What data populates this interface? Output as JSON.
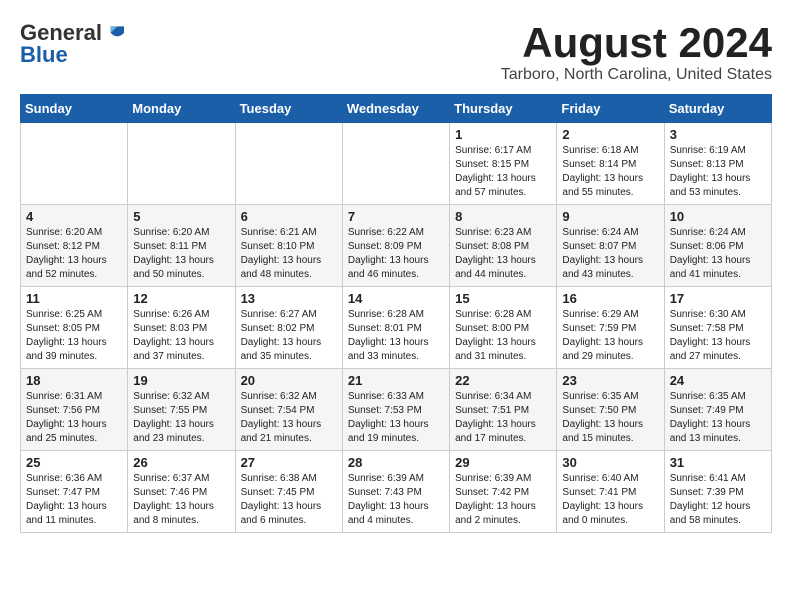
{
  "header": {
    "logo_general": "General",
    "logo_blue": "Blue",
    "month_title": "August 2024",
    "location": "Tarboro, North Carolina, United States"
  },
  "weekdays": [
    "Sunday",
    "Monday",
    "Tuesday",
    "Wednesday",
    "Thursday",
    "Friday",
    "Saturday"
  ],
  "weeks": [
    [
      {
        "day": "",
        "info": ""
      },
      {
        "day": "",
        "info": ""
      },
      {
        "day": "",
        "info": ""
      },
      {
        "day": "",
        "info": ""
      },
      {
        "day": "1",
        "info": "Sunrise: 6:17 AM\nSunset: 8:15 PM\nDaylight: 13 hours\nand 57 minutes."
      },
      {
        "day": "2",
        "info": "Sunrise: 6:18 AM\nSunset: 8:14 PM\nDaylight: 13 hours\nand 55 minutes."
      },
      {
        "day": "3",
        "info": "Sunrise: 6:19 AM\nSunset: 8:13 PM\nDaylight: 13 hours\nand 53 minutes."
      }
    ],
    [
      {
        "day": "4",
        "info": "Sunrise: 6:20 AM\nSunset: 8:12 PM\nDaylight: 13 hours\nand 52 minutes."
      },
      {
        "day": "5",
        "info": "Sunrise: 6:20 AM\nSunset: 8:11 PM\nDaylight: 13 hours\nand 50 minutes."
      },
      {
        "day": "6",
        "info": "Sunrise: 6:21 AM\nSunset: 8:10 PM\nDaylight: 13 hours\nand 48 minutes."
      },
      {
        "day": "7",
        "info": "Sunrise: 6:22 AM\nSunset: 8:09 PM\nDaylight: 13 hours\nand 46 minutes."
      },
      {
        "day": "8",
        "info": "Sunrise: 6:23 AM\nSunset: 8:08 PM\nDaylight: 13 hours\nand 44 minutes."
      },
      {
        "day": "9",
        "info": "Sunrise: 6:24 AM\nSunset: 8:07 PM\nDaylight: 13 hours\nand 43 minutes."
      },
      {
        "day": "10",
        "info": "Sunrise: 6:24 AM\nSunset: 8:06 PM\nDaylight: 13 hours\nand 41 minutes."
      }
    ],
    [
      {
        "day": "11",
        "info": "Sunrise: 6:25 AM\nSunset: 8:05 PM\nDaylight: 13 hours\nand 39 minutes."
      },
      {
        "day": "12",
        "info": "Sunrise: 6:26 AM\nSunset: 8:03 PM\nDaylight: 13 hours\nand 37 minutes."
      },
      {
        "day": "13",
        "info": "Sunrise: 6:27 AM\nSunset: 8:02 PM\nDaylight: 13 hours\nand 35 minutes."
      },
      {
        "day": "14",
        "info": "Sunrise: 6:28 AM\nSunset: 8:01 PM\nDaylight: 13 hours\nand 33 minutes."
      },
      {
        "day": "15",
        "info": "Sunrise: 6:28 AM\nSunset: 8:00 PM\nDaylight: 13 hours\nand 31 minutes."
      },
      {
        "day": "16",
        "info": "Sunrise: 6:29 AM\nSunset: 7:59 PM\nDaylight: 13 hours\nand 29 minutes."
      },
      {
        "day": "17",
        "info": "Sunrise: 6:30 AM\nSunset: 7:58 PM\nDaylight: 13 hours\nand 27 minutes."
      }
    ],
    [
      {
        "day": "18",
        "info": "Sunrise: 6:31 AM\nSunset: 7:56 PM\nDaylight: 13 hours\nand 25 minutes."
      },
      {
        "day": "19",
        "info": "Sunrise: 6:32 AM\nSunset: 7:55 PM\nDaylight: 13 hours\nand 23 minutes."
      },
      {
        "day": "20",
        "info": "Sunrise: 6:32 AM\nSunset: 7:54 PM\nDaylight: 13 hours\nand 21 minutes."
      },
      {
        "day": "21",
        "info": "Sunrise: 6:33 AM\nSunset: 7:53 PM\nDaylight: 13 hours\nand 19 minutes."
      },
      {
        "day": "22",
        "info": "Sunrise: 6:34 AM\nSunset: 7:51 PM\nDaylight: 13 hours\nand 17 minutes."
      },
      {
        "day": "23",
        "info": "Sunrise: 6:35 AM\nSunset: 7:50 PM\nDaylight: 13 hours\nand 15 minutes."
      },
      {
        "day": "24",
        "info": "Sunrise: 6:35 AM\nSunset: 7:49 PM\nDaylight: 13 hours\nand 13 minutes."
      }
    ],
    [
      {
        "day": "25",
        "info": "Sunrise: 6:36 AM\nSunset: 7:47 PM\nDaylight: 13 hours\nand 11 minutes."
      },
      {
        "day": "26",
        "info": "Sunrise: 6:37 AM\nSunset: 7:46 PM\nDaylight: 13 hours\nand 8 minutes."
      },
      {
        "day": "27",
        "info": "Sunrise: 6:38 AM\nSunset: 7:45 PM\nDaylight: 13 hours\nand 6 minutes."
      },
      {
        "day": "28",
        "info": "Sunrise: 6:39 AM\nSunset: 7:43 PM\nDaylight: 13 hours\nand 4 minutes."
      },
      {
        "day": "29",
        "info": "Sunrise: 6:39 AM\nSunset: 7:42 PM\nDaylight: 13 hours\nand 2 minutes."
      },
      {
        "day": "30",
        "info": "Sunrise: 6:40 AM\nSunset: 7:41 PM\nDaylight: 13 hours\nand 0 minutes."
      },
      {
        "day": "31",
        "info": "Sunrise: 6:41 AM\nSunset: 7:39 PM\nDaylight: 12 hours\nand 58 minutes."
      }
    ]
  ]
}
